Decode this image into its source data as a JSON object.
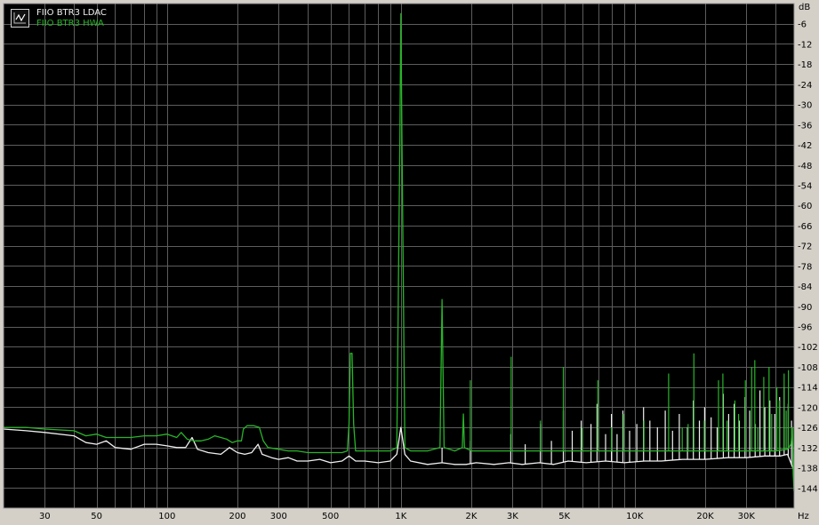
{
  "colors": {
    "background": "#000000",
    "grid": "#5d5d5d",
    "frame": "#9a9a9a",
    "axis_text": "#000000"
  },
  "chart_data": {
    "type": "line",
    "title": "",
    "xlabel": "Hz",
    "ylabel": "dB",
    "xscale": "log",
    "xlim": [
      20,
      48000
    ],
    "ylim": [
      -150,
      0
    ],
    "grid": true,
    "legend_position": "top-left",
    "x_ticks": [
      {
        "value": 30,
        "label": "30"
      },
      {
        "value": 50,
        "label": "50"
      },
      {
        "value": 100,
        "label": "100"
      },
      {
        "value": 200,
        "label": "200"
      },
      {
        "value": 300,
        "label": "300"
      },
      {
        "value": 500,
        "label": "500"
      },
      {
        "value": 1000,
        "label": "1K"
      },
      {
        "value": 2000,
        "label": "2K"
      },
      {
        "value": 3000,
        "label": "3K"
      },
      {
        "value": 5000,
        "label": "5K"
      },
      {
        "value": 10000,
        "label": "10K"
      },
      {
        "value": 20000,
        "label": "20K"
      },
      {
        "value": 30000,
        "label": "30K"
      }
    ],
    "y_ticks": [
      -6,
      -12,
      -18,
      -24,
      -30,
      -36,
      -42,
      -48,
      -54,
      -60,
      -66,
      -72,
      -78,
      -84,
      -90,
      -96,
      -102,
      -108,
      -114,
      -120,
      -126,
      -132,
      -138,
      -144
    ],
    "series": [
      {
        "name": "FIIO BTR3 LDAC",
        "color": "#f0f0f0",
        "points": [
          [
            20,
            -126.5
          ],
          [
            25,
            -127
          ],
          [
            30,
            -127.5
          ],
          [
            40,
            -128.5
          ],
          [
            45,
            -130.5
          ],
          [
            50,
            -131
          ],
          [
            55,
            -130
          ],
          [
            60,
            -132
          ],
          [
            70,
            -132.5
          ],
          [
            80,
            -131
          ],
          [
            90,
            -131
          ],
          [
            100,
            -131.5
          ],
          [
            110,
            -132
          ],
          [
            120,
            -132
          ],
          [
            128,
            -129
          ],
          [
            135,
            -132.5
          ],
          [
            150,
            -133.5
          ],
          [
            170,
            -134
          ],
          [
            185,
            -132
          ],
          [
            200,
            -133.5
          ],
          [
            215,
            -134
          ],
          [
            230,
            -133.5
          ],
          [
            245,
            -131
          ],
          [
            255,
            -134
          ],
          [
            280,
            -135
          ],
          [
            300,
            -135.5
          ],
          [
            330,
            -135
          ],
          [
            360,
            -136
          ],
          [
            400,
            -136
          ],
          [
            450,
            -135.5
          ],
          [
            500,
            -136.5
          ],
          [
            560,
            -136
          ],
          [
            600,
            -134.5
          ],
          [
            640,
            -136
          ],
          [
            700,
            -136
          ],
          [
            800,
            -136.5
          ],
          [
            900,
            -136
          ],
          [
            960,
            -134
          ],
          [
            1000,
            -126
          ],
          [
            1040,
            -134
          ],
          [
            1100,
            -136
          ],
          [
            1300,
            -137
          ],
          [
            1500,
            -136.5
          ],
          [
            1700,
            -137
          ],
          [
            1900,
            -137
          ],
          [
            2100,
            -136.5
          ],
          [
            2500,
            -137
          ],
          [
            2900,
            -136.5
          ],
          [
            3300,
            -137
          ],
          [
            3900,
            -136.5
          ],
          [
            4500,
            -137
          ],
          [
            5200,
            -136
          ],
          [
            6200,
            -136.5
          ],
          [
            7500,
            -136
          ],
          [
            9000,
            -136.5
          ],
          [
            11000,
            -136
          ],
          [
            13000,
            -136
          ],
          [
            16000,
            -135.5
          ],
          [
            20000,
            -135.5
          ],
          [
            25000,
            -135
          ],
          [
            30000,
            -135
          ],
          [
            36000,
            -134.5
          ],
          [
            42000,
            -134.5
          ],
          [
            45000,
            -134
          ],
          [
            48000,
            -139
          ]
        ],
        "spikes": [
          [
            1500,
            -132
          ],
          [
            1980,
            -130
          ],
          [
            2950,
            -128
          ],
          [
            3400,
            -131
          ],
          [
            3950,
            -125
          ],
          [
            4400,
            -130
          ],
          [
            4950,
            -121
          ],
          [
            5400,
            -127
          ],
          [
            5900,
            -124
          ],
          [
            6500,
            -125
          ],
          [
            6900,
            -119
          ],
          [
            7500,
            -128
          ],
          [
            7950,
            -122
          ],
          [
            8400,
            -128
          ],
          [
            8900,
            -121
          ],
          [
            9500,
            -127
          ],
          [
            10200,
            -125
          ],
          [
            10900,
            -120
          ],
          [
            11600,
            -124
          ],
          [
            12500,
            -126
          ],
          [
            13500,
            -121
          ],
          [
            14500,
            -127
          ],
          [
            15500,
            -122
          ],
          [
            16800,
            -126
          ],
          [
            17800,
            -118
          ],
          [
            18900,
            -124
          ],
          [
            19900,
            -120
          ],
          [
            21200,
            -123
          ],
          [
            22500,
            -126
          ],
          [
            23900,
            -116
          ],
          [
            25200,
            -122
          ],
          [
            26600,
            -119
          ],
          [
            28000,
            -124
          ],
          [
            29600,
            -117
          ],
          [
            31000,
            -121
          ],
          [
            32700,
            -125
          ],
          [
            34300,
            -115
          ],
          [
            36000,
            -120
          ],
          [
            37800,
            -118
          ],
          [
            39700,
            -122
          ],
          [
            41600,
            -117
          ],
          [
            43500,
            -114
          ],
          [
            45300,
            -119
          ],
          [
            46800,
            -124
          ]
        ]
      },
      {
        "name": "FIIO BTR3 HWA",
        "color": "#28b428",
        "points": [
          [
            20,
            -126
          ],
          [
            25,
            -126
          ],
          [
            30,
            -126.5
          ],
          [
            40,
            -127
          ],
          [
            45,
            -128.5
          ],
          [
            50,
            -128
          ],
          [
            55,
            -129
          ],
          [
            60,
            -129
          ],
          [
            70,
            -129
          ],
          [
            80,
            -128.5
          ],
          [
            90,
            -128.5
          ],
          [
            100,
            -128
          ],
          [
            110,
            -129
          ],
          [
            115,
            -127.5
          ],
          [
            122,
            -129.5
          ],
          [
            130,
            -130
          ],
          [
            140,
            -130
          ],
          [
            150,
            -129.5
          ],
          [
            160,
            -128.5
          ],
          [
            170,
            -129
          ],
          [
            180,
            -129.5
          ],
          [
            190,
            -130.5
          ],
          [
            200,
            -130
          ],
          [
            208,
            -130
          ],
          [
            212,
            -126.5
          ],
          [
            220,
            -125.5
          ],
          [
            235,
            -125.5
          ],
          [
            248,
            -126
          ],
          [
            258,
            -130
          ],
          [
            270,
            -132
          ],
          [
            300,
            -132.5
          ],
          [
            330,
            -133
          ],
          [
            360,
            -133
          ],
          [
            400,
            -133.5
          ],
          [
            450,
            -133.5
          ],
          [
            500,
            -133.5
          ],
          [
            560,
            -133.5
          ],
          [
            590,
            -133
          ],
          [
            600,
            -125
          ],
          [
            608,
            -104
          ],
          [
            618,
            -104
          ],
          [
            628,
            -125
          ],
          [
            640,
            -133
          ],
          [
            700,
            -133
          ],
          [
            800,
            -133
          ],
          [
            900,
            -133
          ],
          [
            960,
            -132
          ],
          [
            990,
            -40
          ],
          [
            1000,
            -3
          ],
          [
            1010,
            -40
          ],
          [
            1040,
            -132
          ],
          [
            1100,
            -133
          ],
          [
            1300,
            -133
          ],
          [
            1470,
            -132
          ],
          [
            1500,
            -88
          ],
          [
            1530,
            -132
          ],
          [
            1700,
            -133
          ],
          [
            1830,
            -132
          ],
          [
            1850,
            -122
          ],
          [
            1870,
            -132
          ],
          [
            2000,
            -133
          ],
          [
            2500,
            -133
          ],
          [
            3000,
            -133
          ],
          [
            4000,
            -133
          ],
          [
            5000,
            -133
          ],
          [
            6000,
            -133
          ],
          [
            8000,
            -133
          ],
          [
            10000,
            -133
          ],
          [
            12000,
            -133
          ],
          [
            15000,
            -133
          ],
          [
            20000,
            -133
          ],
          [
            25000,
            -133
          ],
          [
            30000,
            -133
          ],
          [
            35000,
            -133
          ],
          [
            40000,
            -133
          ],
          [
            45000,
            -132.5
          ],
          [
            46500,
            -131
          ],
          [
            47200,
            -126
          ],
          [
            47600,
            -140
          ],
          [
            48000,
            -145
          ]
        ],
        "spikes": [
          [
            1980,
            -112
          ],
          [
            2960,
            -105
          ],
          [
            3950,
            -124
          ],
          [
            4950,
            -108
          ],
          [
            5950,
            -126
          ],
          [
            6950,
            -112
          ],
          [
            7950,
            -126
          ],
          [
            8950,
            -122
          ],
          [
            10950,
            -124
          ],
          [
            13950,
            -110
          ],
          [
            15950,
            -126
          ],
          [
            16900,
            -125
          ],
          [
            17900,
            -104
          ],
          [
            19800,
            -124
          ],
          [
            22800,
            -112
          ],
          [
            23800,
            -110
          ],
          [
            24800,
            -124
          ],
          [
            26800,
            -118
          ],
          [
            27800,
            -122
          ],
          [
            29700,
            -112
          ],
          [
            31600,
            -108
          ],
          [
            32600,
            -106
          ],
          [
            33600,
            -126
          ],
          [
            35600,
            -111
          ],
          [
            37500,
            -108
          ],
          [
            38500,
            -122
          ],
          [
            40500,
            -114
          ],
          [
            41500,
            -118
          ],
          [
            43500,
            -110
          ],
          [
            44400,
            -121
          ],
          [
            45400,
            -109
          ],
          [
            46800,
            -126
          ]
        ]
      }
    ]
  }
}
